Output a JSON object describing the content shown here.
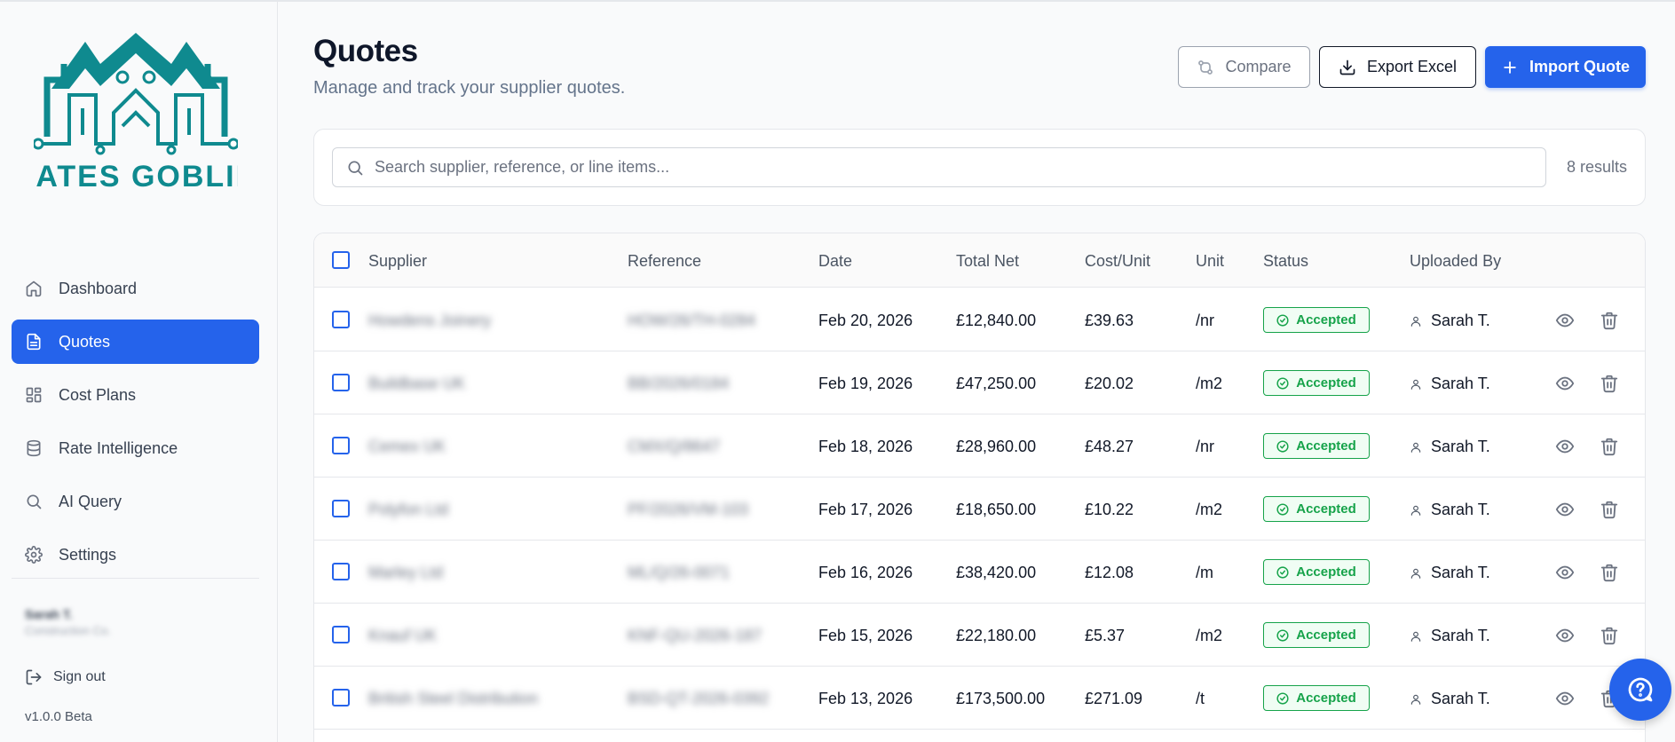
{
  "brand": {
    "name": "RATES GOBLIN",
    "primary_color": "#2563eb",
    "logo_color": "#0f8a8f"
  },
  "sidebar": {
    "items": [
      {
        "label": "Dashboard",
        "icon": "home-icon",
        "active": false
      },
      {
        "label": "Quotes",
        "icon": "document-icon",
        "active": true
      },
      {
        "label": "Cost Plans",
        "icon": "grid-icon",
        "active": false
      },
      {
        "label": "Rate Intelligence",
        "icon": "database-icon",
        "active": false
      },
      {
        "label": "AI Query",
        "icon": "search-icon",
        "active": false
      },
      {
        "label": "Settings",
        "icon": "gear-icon",
        "active": false
      }
    ],
    "user": {
      "name": "Sarah T.",
      "company": "Construction Co."
    },
    "sign_out_label": "Sign out",
    "version": "v1.0.0 Beta"
  },
  "header": {
    "title": "Quotes",
    "subtitle": "Manage and track your supplier quotes.",
    "compare_label": "Compare",
    "export_label": "Export Excel",
    "import_label": "Import Quote"
  },
  "search": {
    "placeholder": "Search supplier, reference, or line items...",
    "results_text": "8 results"
  },
  "table": {
    "columns": [
      "Supplier",
      "Reference",
      "Date",
      "Total Net",
      "Cost/Unit",
      "Unit",
      "Status",
      "Uploaded By"
    ],
    "rows": [
      {
        "supplier": "Howdens Joinery",
        "reference": "HOW/26/TH-0284",
        "date": "Feb 20, 2026",
        "total_net": "£12,840.00",
        "cost_unit": "£39.63",
        "unit": "/nr",
        "status": "Accepted",
        "uploaded_by": "Sarah T."
      },
      {
        "supplier": "Buildbase UK",
        "reference": "BB/2026/0184",
        "date": "Feb 19, 2026",
        "total_net": "£47,250.00",
        "cost_unit": "£20.02",
        "unit": "/m2",
        "status": "Accepted",
        "uploaded_by": "Sarah T."
      },
      {
        "supplier": "Cemex UK",
        "reference": "CMX/Q/8647",
        "date": "Feb 18, 2026",
        "total_net": "£28,960.00",
        "cost_unit": "£48.27",
        "unit": "/nr",
        "status": "Accepted",
        "uploaded_by": "Sarah T."
      },
      {
        "supplier": "Polyfon Ltd",
        "reference": "PF/2026/VM-103",
        "date": "Feb 17, 2026",
        "total_net": "£18,650.00",
        "cost_unit": "£10.22",
        "unit": "/m2",
        "status": "Accepted",
        "uploaded_by": "Sarah T."
      },
      {
        "supplier": "Marley Ltd",
        "reference": "ML/Q/26-0071",
        "date": "Feb 16, 2026",
        "total_net": "£38,420.00",
        "cost_unit": "£12.08",
        "unit": "/m",
        "status": "Accepted",
        "uploaded_by": "Sarah T."
      },
      {
        "supplier": "Knauf UK",
        "reference": "KNF-QU-2026-187",
        "date": "Feb 15, 2026",
        "total_net": "£22,180.00",
        "cost_unit": "£5.37",
        "unit": "/m2",
        "status": "Accepted",
        "uploaded_by": "Sarah T."
      },
      {
        "supplier": "British Steel Distribution",
        "reference": "BSD-QT-2026-0392",
        "date": "Feb 13, 2026",
        "total_net": "£173,500.00",
        "cost_unit": "£271.09",
        "unit": "/t",
        "status": "Accepted",
        "uploaded_by": "Sarah T."
      }
    ],
    "status_color": "#16a34a"
  }
}
